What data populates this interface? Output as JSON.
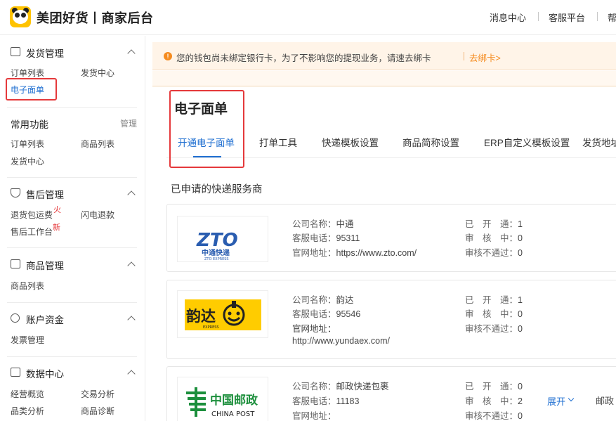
{
  "header": {
    "brand": "美团好货丨商家后台",
    "nav": [
      "消息中心",
      "客服平台",
      "帮"
    ]
  },
  "sidebar": {
    "shipping": {
      "title": "发货管理",
      "items": [
        "订单列表",
        "发货中心",
        "电子面单"
      ],
      "active": "电子面单"
    },
    "common": {
      "title": "常用功能",
      "manage": "管理",
      "items": [
        "订单列表",
        "商品列表",
        "发货中心"
      ]
    },
    "aftersale": {
      "title": "售后管理",
      "items": [
        "退货包运费",
        "闪电退款",
        "售后工作台"
      ],
      "tag1": "火",
      "tag2": "新"
    },
    "goods": {
      "title": "商品管理",
      "items": [
        "商品列表"
      ]
    },
    "account": {
      "title": "账户资金",
      "items": [
        "发票管理"
      ]
    },
    "data": {
      "title": "数据中心",
      "items": [
        "经营概览",
        "交易分析",
        "品类分析",
        "商品诊断"
      ]
    }
  },
  "banner": {
    "message": "您的钱包尚未绑定银行卡，为了不影响您的提现业务，请速去绑卡",
    "link": "去绑卡>",
    "icon": "warning-icon",
    "color": "#f58b1f"
  },
  "page": {
    "title": "电子面单",
    "tabs": [
      "开通电子面单",
      "打单工具",
      "快递模板设置",
      "商品简称设置",
      "ERP自定义模板设置",
      "发货地址"
    ],
    "active_tab": "开通电子面单",
    "section_title": "已申请的快递服务商"
  },
  "labels": {
    "company": "公司名称：",
    "phone": "客服电话：",
    "site": "官网地址：",
    "opened": "已　开　通：",
    "reviewing": "审　核　中：",
    "rejected": "审核不通过："
  },
  "carriers": [
    {
      "name": "中通",
      "phone": "95311",
      "site": "https://www.zto.com/",
      "opened": "1",
      "reviewing": "0",
      "rejected": "0",
      "logo_text": "ZTO",
      "logo_sub": "中通快递",
      "logo_en": "ZTO EXPRESS"
    },
    {
      "name": "韵达",
      "phone": "95546",
      "site": "http://www.yundaex.com/",
      "opened": "1",
      "reviewing": "0",
      "rejected": "0",
      "logo_text": "韵达",
      "logo_en": "EXPRESS"
    },
    {
      "name": "邮政快递包裹",
      "phone": "11183",
      "site": "",
      "opened": "0",
      "reviewing": "2",
      "rejected": "0",
      "logo_text": "中国邮政",
      "logo_en": "CHINA POST"
    }
  ],
  "expand_label": "展开",
  "cut_text": "邮政"
}
